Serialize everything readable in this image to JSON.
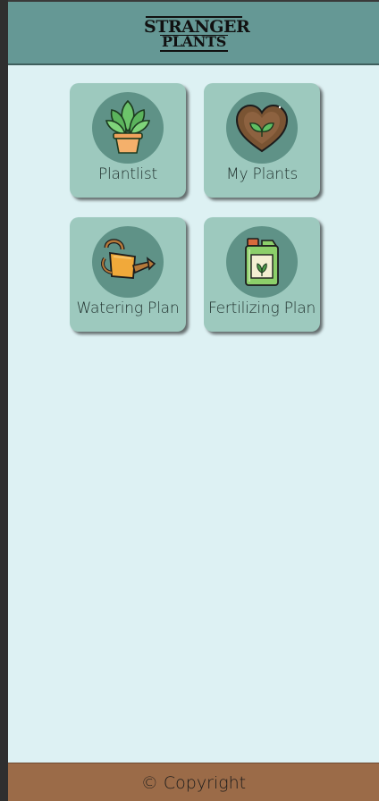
{
  "header": {
    "logo_line1": "STRANGER",
    "logo_line2": "PLANTS"
  },
  "tiles": [
    {
      "label": "Plantlist",
      "icon": "potted-plant-icon"
    },
    {
      "label": "My Plants",
      "icon": "heart-leaf-icon"
    },
    {
      "label": "Watering Plan",
      "icon": "watering-can-icon"
    },
    {
      "label": "Fertilizing Plan",
      "icon": "fertilizer-canister-icon"
    }
  ],
  "footer": {
    "copyright": "© Copyright"
  },
  "colors": {
    "header": "#659895",
    "background": "#ddf1f3",
    "tile": "#9dc9be",
    "icon_circle": "#5f9287",
    "footer": "#9b6b48"
  }
}
